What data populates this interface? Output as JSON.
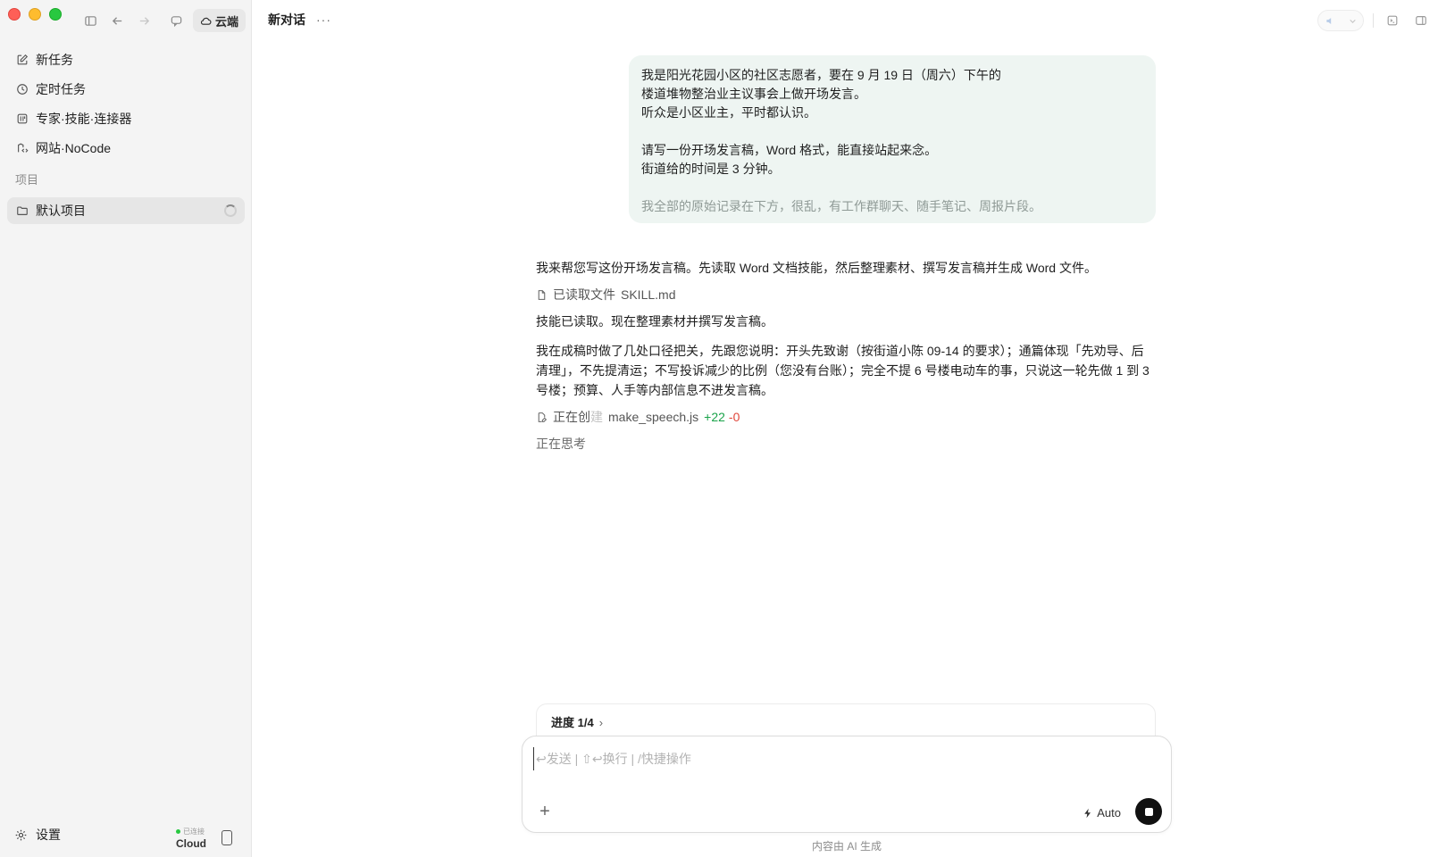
{
  "window": {
    "cloud_label": "云端"
  },
  "sidebar": {
    "nav": [
      {
        "label": "新任务",
        "icon": "edit-icon"
      },
      {
        "label": "定时任务",
        "icon": "clock-icon"
      },
      {
        "label": "专家·技能·连接器",
        "icon": "grid-icon"
      },
      {
        "label": "网站·NoCode",
        "icon": "code-icon"
      }
    ],
    "section_label": "项目",
    "project": {
      "label": "默认项目",
      "status": "loading"
    },
    "settings_label": "设置",
    "connection": {
      "status": "已连接",
      "name": "Cloud",
      "status_color": "#28c840"
    }
  },
  "header": {
    "title": "新对话",
    "more": "···"
  },
  "conversation": {
    "user_message": {
      "lines": [
        "我是阳光花园小区的社区志愿者，要在 9 月 19 日（周六）下午的",
        "楼道堆物整治业主议事会上做开场发言。",
        "听众是小区业主，平时都认识。",
        "",
        "请写一份开场发言稿，Word 格式，能直接站起来念。",
        "街道给的时间是 3 分钟。",
        ""
      ],
      "note": "我全部的原始记录在下方，很乱，有工作群聊天、随手笔记、周报片段。"
    },
    "assistant": {
      "intro": "我来帮您写这份开场发言稿。先读取 Word 文档技能，然后整理素材、撰写发言稿并生成 Word 文件。",
      "read_file": {
        "prefix": "已读取文件",
        "name": "SKILL.md"
      },
      "status_line": "技能已读取。现在整理素材并撰写发言稿。",
      "explanation": "我在成稿时做了几处口径把关，先跟您说明：开头先致谢（按街道小陈 09-14 的要求）；通篇体现「先劝导、后清理」，不先提清运；不写投诉减少的比例（您没有台账）；完全不提 6 号楼电动车的事，只说这一轮先做 1 到 3 号楼；预算、人手等内部信息不进发言稿。",
      "creating_file": {
        "prefix": "正在创",
        "prefix_fade": "建",
        "name": "make_speech.js",
        "additions": "+22",
        "deletions": "-0"
      },
      "thinking": "正在思考"
    }
  },
  "progress": {
    "label": "进度 1/4",
    "chevron": "›"
  },
  "composer": {
    "placeholder": "↩发送 | ⇧↩换行 | /快捷操作",
    "plus": "+",
    "mode_label": "Auto"
  },
  "footer_note": "内容由 AI 生成"
}
